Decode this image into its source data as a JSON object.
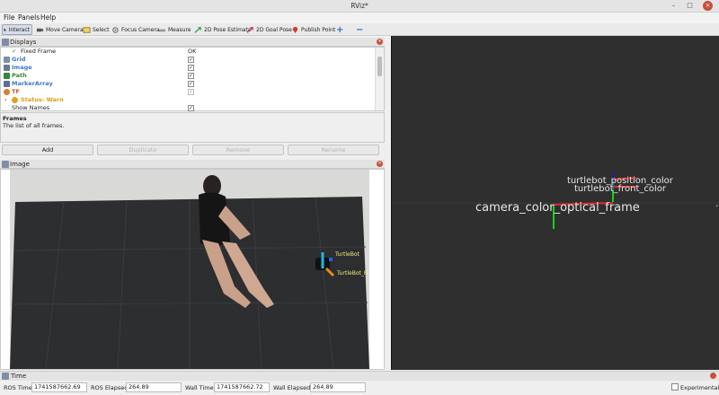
{
  "window": {
    "title": "RViz*"
  },
  "menu": {
    "file": "File",
    "panels": "Panels",
    "help": "Help"
  },
  "toolbar": {
    "interact": "Interact",
    "move_camera": "Move Camera",
    "select": "Select",
    "focus_camera": "Focus Camera",
    "measure": "Measure",
    "pose_estimate": "2D Pose Estimate",
    "goal_pose": "2D Goal Pose",
    "publish_point": "Publish Point"
  },
  "displays": {
    "title": "Displays",
    "rows": [
      {
        "label": "Fixed Frame",
        "value": "OK"
      },
      {
        "label": "Grid",
        "color": "#3a78c9"
      },
      {
        "label": "Image",
        "color": "#3a78c9"
      },
      {
        "label": "Path",
        "color": "#2f8a37"
      },
      {
        "label": "MarkerArray",
        "color": "#3a78c9"
      },
      {
        "label": "TF",
        "color": "#c85a1a"
      },
      {
        "label": "Status: Warn",
        "color": "#d4a017"
      },
      {
        "label": "Show Names"
      }
    ],
    "description": {
      "title": "Frames",
      "text": "The list of all frames."
    },
    "buttons": {
      "add": "Add",
      "duplicate": "Duplicate",
      "remove": "Remove",
      "rename": "Rename"
    }
  },
  "image_panel": {
    "title": "Image",
    "overlay": {
      "turtlebot": "TurtleBot",
      "turtlebot_front": "TurtleBot_Fr"
    }
  },
  "view3d": {
    "labels": {
      "position": "turtlebot_position_color",
      "front": "turtlebot_front_color",
      "optical": "camera_color_optical_frame"
    }
  },
  "time": {
    "title": "Time",
    "ros_time_label": "ROS Time:",
    "ros_time": "1741587662.69",
    "ros_elapsed_label": "ROS Elapsed:",
    "ros_elapsed": "264.89",
    "wall_time_label": "Wall Time:",
    "wall_time": "1741587662.72",
    "wall_elapsed_label": "Wall Elapsed:",
    "wall_elapsed": "264.89",
    "experimental": "Experimental"
  }
}
